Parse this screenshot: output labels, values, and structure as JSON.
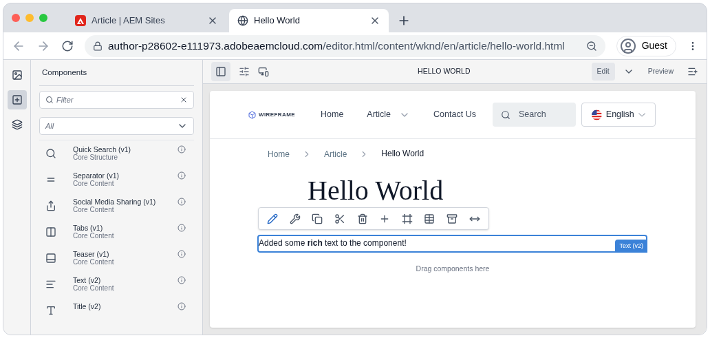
{
  "browser": {
    "tabs": [
      {
        "title": "Article | AEM Sites",
        "selected": false,
        "kind": "adobe"
      },
      {
        "title": "Hello World",
        "selected": true,
        "kind": "globe"
      }
    ],
    "url": {
      "host": "author-p28602-e111973.adobeaemcloud.com",
      "path": "/editor.html/content/wknd/en/article/hello-world.html"
    },
    "profile": "Guest"
  },
  "rail": [
    {
      "kind": "assets",
      "selected": false
    },
    {
      "kind": "components",
      "selected": true
    },
    {
      "kind": "layers",
      "selected": false
    }
  ],
  "panel": {
    "title": "Components",
    "filter_placeholder": "Filter",
    "group": "All",
    "items": [
      {
        "kind": "search",
        "name": "Quick Search (v1)",
        "group": "Core Structure"
      },
      {
        "kind": "separator",
        "name": "Separator (v1)",
        "group": "Core Content"
      },
      {
        "kind": "share",
        "name": "Social Media Sharing (v1)",
        "group": "Core Content"
      },
      {
        "kind": "tabs",
        "name": "Tabs (v1)",
        "group": "Core Content"
      },
      {
        "kind": "teaser",
        "name": "Teaser (v1)",
        "group": "Core Content"
      },
      {
        "kind": "text",
        "name": "Text (v2)",
        "group": "Core Content"
      },
      {
        "kind": "title",
        "name": "Title (v2)"
      }
    ]
  },
  "editor": {
    "toolbar_title": "HELLO WORLD",
    "modes": [
      {
        "label": "Edit",
        "selected": true
      },
      {
        "label": "Preview",
        "selected": false
      }
    ]
  },
  "page": {
    "logo": "WIREFRAME",
    "nav": [
      {
        "label": "Home",
        "dropdown": false
      },
      {
        "label": "Article",
        "dropdown": true
      },
      {
        "label": "Contact Us",
        "dropdown": false
      }
    ],
    "search_placeholder": "Search",
    "language": "English",
    "breadcrumbs": [
      {
        "label": "Home",
        "current": false
      },
      {
        "label": "Article",
        "current": false
      },
      {
        "label": "Hello World",
        "current": true
      }
    ],
    "heading": "Hello World",
    "text": "Added some **rich** text to the component!",
    "component_label": "Text (v2)",
    "drop_hint": "Drag components here"
  }
}
